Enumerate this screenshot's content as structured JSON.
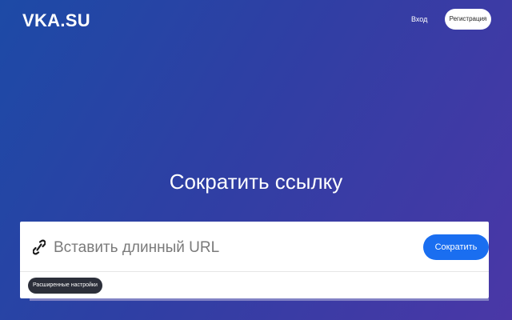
{
  "header": {
    "logo": "VKA.SU",
    "login_label": "Вход",
    "register_label": "Регистрация"
  },
  "main": {
    "headline": "Сократить ссылку",
    "url_input": {
      "placeholder": "Вставить длинный URL",
      "value": ""
    },
    "shorten_label": "Сократить",
    "advanced_label": "Расширенные настройки",
    "link_icon": "link-icon"
  },
  "colors": {
    "gradient_start": "#1d4aa6",
    "gradient_end": "#4a37a6",
    "primary_button": "#1a6ef0",
    "advanced_button": "#2c2f3a"
  }
}
